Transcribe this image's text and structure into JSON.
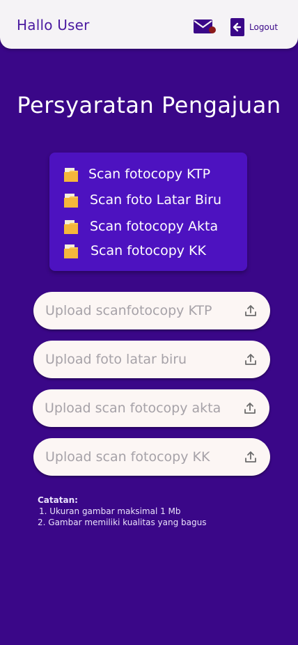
{
  "header": {
    "greeting": "Hallo User",
    "logout_label": "Logout"
  },
  "page_title": "Persyaratan Pengajuan",
  "requirements": [
    {
      "label": "Scan fotocopy KTP",
      "icon": "folder-icon"
    },
    {
      "label": "Scan foto Latar Biru",
      "icon": "folder-icon"
    },
    {
      "label": "Scan fotocopy Akta",
      "icon": "folder-icon"
    },
    {
      "label": "Scan fotocopy KK",
      "icon": "folder-icon"
    }
  ],
  "uploads": [
    {
      "placeholder": "Upload scanfotocopy KTP",
      "icon": "upload-icon"
    },
    {
      "placeholder": "Upload foto latar biru",
      "icon": "upload-icon"
    },
    {
      "placeholder": "Upload scan fotocopy akta",
      "icon": "upload-icon"
    },
    {
      "placeholder": "Upload scan fotocopy KK",
      "icon": "upload-icon"
    }
  ],
  "notes": {
    "title": "Catatan:",
    "items": [
      "1. Ukuran gambar maksimal 1 Mb",
      "2. Gambar memiliki kualitas yang bagus"
    ]
  },
  "colors": {
    "background": "#3a0788",
    "header_bg": "#f5f3f6",
    "accent": "#4a1aa0",
    "card_bg": "#4d12c0",
    "upload_bg": "#fcf6f4",
    "notification_dot": "#8b1a1a",
    "folder": "#f5b73b"
  }
}
